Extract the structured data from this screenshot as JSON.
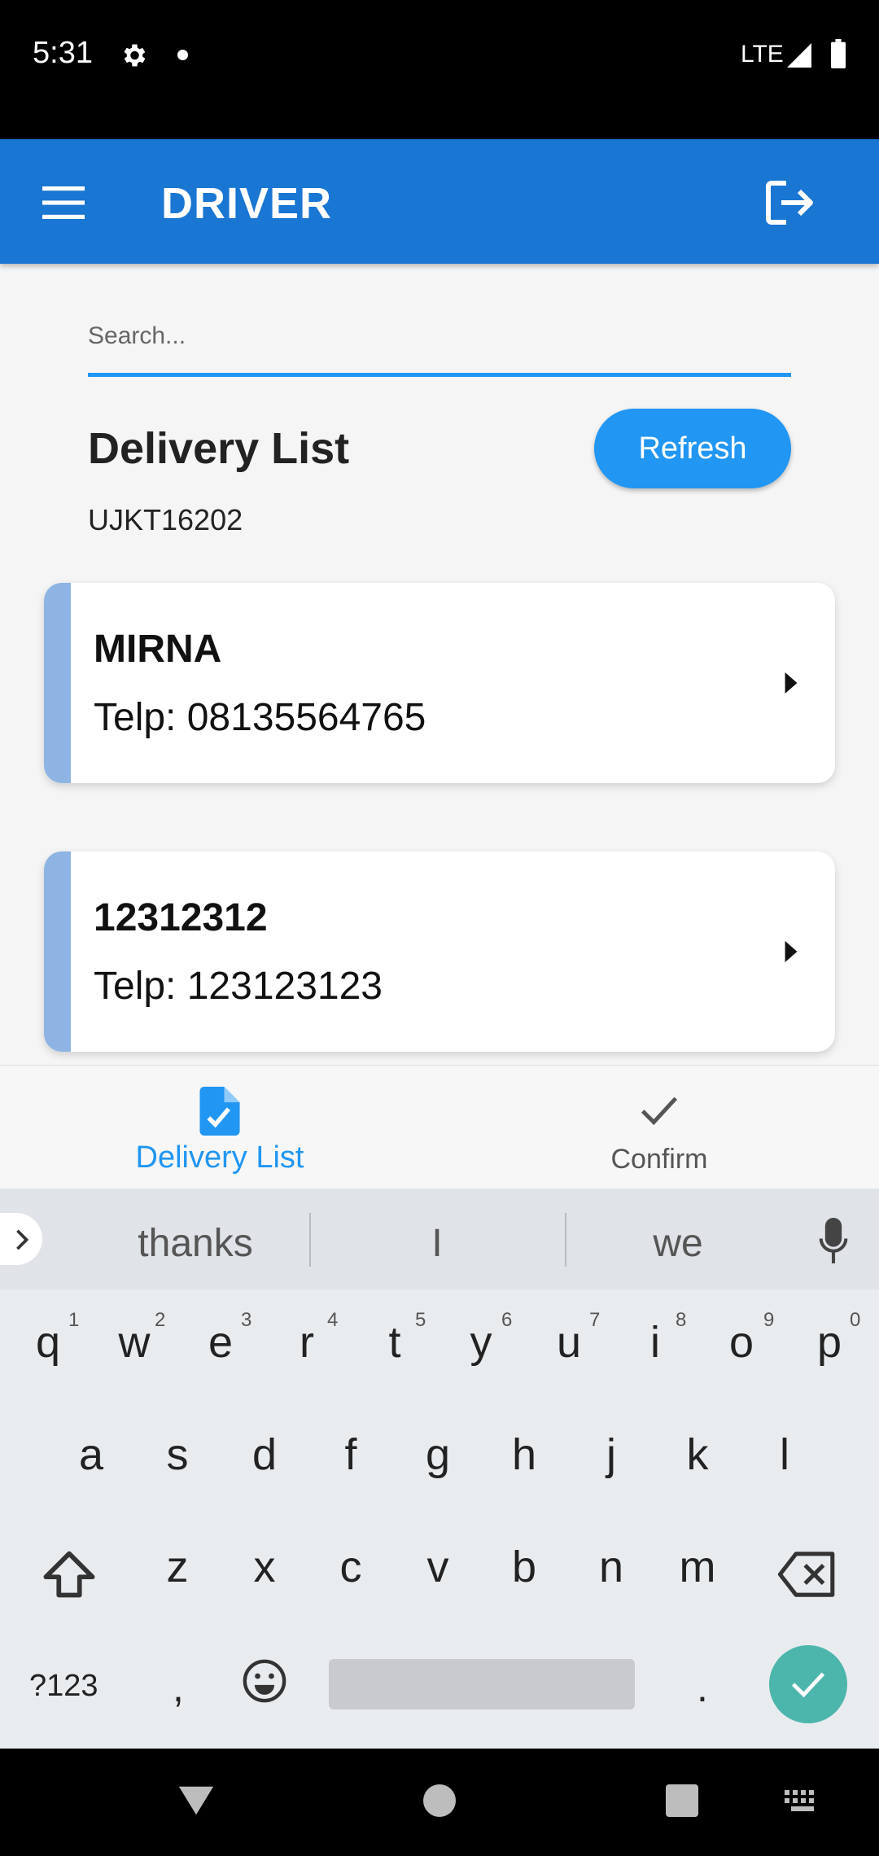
{
  "status_bar": {
    "time": "5:31",
    "network": "LTE"
  },
  "app_bar": {
    "title": "DRIVER"
  },
  "search": {
    "placeholder": "Search..."
  },
  "section": {
    "title": "Delivery List",
    "refresh_label": "Refresh",
    "vehicle_code": "UJKT16202"
  },
  "deliveries": [
    {
      "name": "MIRNA",
      "phone": "Telp: 08135564765"
    },
    {
      "name": "12312312",
      "phone": "Telp: 123123123"
    }
  ],
  "bottom_nav": [
    {
      "label": "Delivery List",
      "active": true
    },
    {
      "label": "Confirm",
      "active": false
    }
  ],
  "keyboard": {
    "suggestions": [
      "thanks",
      "I",
      "we"
    ],
    "row1": [
      "q",
      "w",
      "e",
      "r",
      "t",
      "y",
      "u",
      "i",
      "o",
      "p"
    ],
    "row1_hints": [
      "1",
      "2",
      "3",
      "4",
      "5",
      "6",
      "7",
      "8",
      "9",
      "0"
    ],
    "row2": [
      "a",
      "s",
      "d",
      "f",
      "g",
      "h",
      "j",
      "k",
      "l"
    ],
    "row3": [
      "z",
      "x",
      "c",
      "v",
      "b",
      "n",
      "m"
    ],
    "symbols_label": "?123",
    "comma": ",",
    "period": "."
  },
  "colors": {
    "primary": "#1976d2",
    "accent": "#2196f3",
    "card_accent": "#8eb4e3",
    "enter_key": "#4db6ac"
  }
}
